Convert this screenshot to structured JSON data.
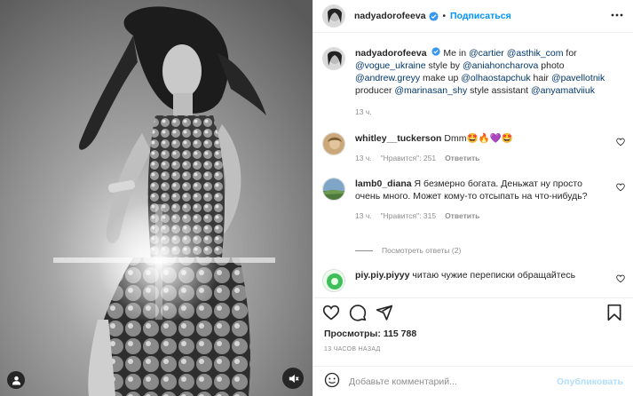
{
  "post": {
    "username": "nadyadorofeeva",
    "follow_label": "Подписаться",
    "dot": "•"
  },
  "caption": {
    "username": "nadyadorofeeva",
    "text_parts": [
      {
        "text": "Me in "
      },
      {
        "text": "@cartier",
        "link": true
      },
      {
        "text": " "
      },
      {
        "text": "@asthik_com",
        "link": true
      },
      {
        "text": " for "
      },
      {
        "text": "@vogue_ukraine",
        "link": true
      },
      {
        "text": " style by "
      },
      {
        "text": "@aniahoncharova",
        "link": true
      },
      {
        "text": " photo "
      },
      {
        "text": "@andrew.greyy",
        "link": true
      },
      {
        "text": " make up "
      },
      {
        "text": "@olhaostapchuk",
        "link": true
      },
      {
        "text": " hair "
      },
      {
        "text": "@pavellotnik",
        "link": true
      },
      {
        "text": " producer "
      },
      {
        "text": "@marinasan_shy",
        "link": true
      },
      {
        "text": " style assistant "
      },
      {
        "text": "@anyamatviiuk",
        "link": true
      }
    ],
    "time": "13 ч."
  },
  "comments": [
    {
      "username": "whitley__tuckerson",
      "text": "Dmm🤩🔥💜🤩",
      "time": "13 ч.",
      "likes": "\"Нравится\": 251",
      "reply": "Ответить"
    },
    {
      "username": "lamb0_diana",
      "text": "Я безмерно богата. Деньжат ну просто очень много. Может кому-то отсыпать на что-нибудь?",
      "time": "13 ч.",
      "likes": "\"Нравится\": 315",
      "reply": "Ответить"
    },
    {
      "username": "piy.piy.piyyy",
      "text": "читаю чужие переписки обращайтесь"
    }
  ],
  "view_replies": "Посмотреть ответы (2)",
  "stats": {
    "views_label": "Просмотры:",
    "views_count": "115 788",
    "timestamp": "13 ЧАСОВ НАЗАД"
  },
  "add_comment": {
    "placeholder": "Добавьте комментарий...",
    "publish_label": "Опубликовать"
  },
  "colors": {
    "accent": "#0095f6",
    "link": "#00376b",
    "muted": "#8e8e8e",
    "publish_disabled": "#b2dffc",
    "verified": "#3897f0"
  },
  "icons": [
    "user-tag-icon",
    "mute-icon",
    "more-icon",
    "verified-icon",
    "heart-icon",
    "comment-icon",
    "share-icon",
    "bookmark-icon",
    "emoji-icon"
  ]
}
